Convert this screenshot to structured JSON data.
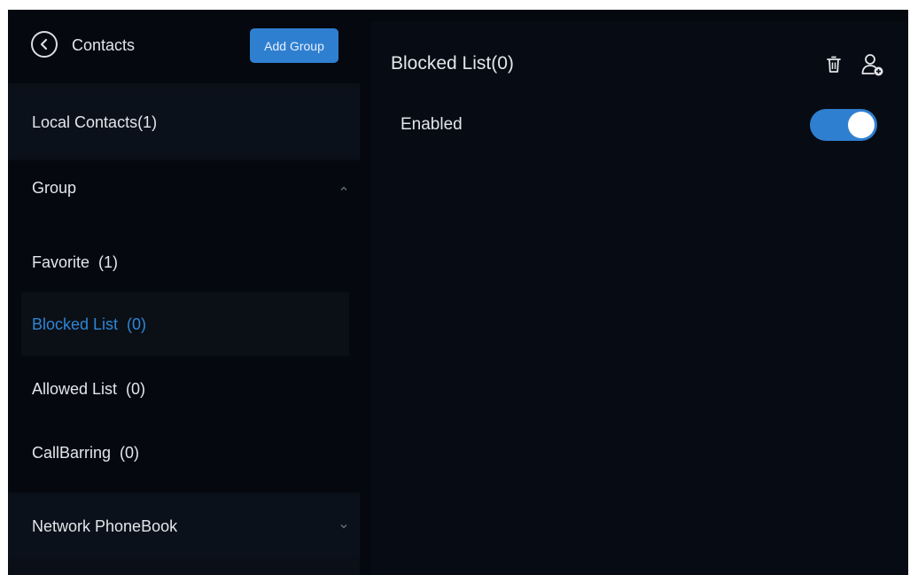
{
  "sidebar": {
    "title": "Contacts",
    "add_group_label": "Add Group",
    "items": {
      "local_contacts": "Local Contacts(1)",
      "group": "Group",
      "favorite": "Favorite  (1)",
      "blocked_list": "Blocked List  (0)",
      "allowed_list": "Allowed List  (0)",
      "call_barring": "CallBarring  (0)",
      "network_phonebook": "Network PhoneBook"
    },
    "selected_item": "blocked_list"
  },
  "panel": {
    "title": "Blocked List(0)",
    "enabled_label": "Enabled",
    "enabled_state": true
  },
  "icons": {
    "back": "back-arrow-icon",
    "delete": "trash-icon",
    "add_contact": "add-contact-icon",
    "expand": "chevron-down-icon",
    "collapse": "chevron-up-icon"
  },
  "colors": {
    "accent": "#2f7fd0",
    "selected_text": "#2e86d6",
    "background": "#05080f",
    "text": "#e3e6ea"
  }
}
